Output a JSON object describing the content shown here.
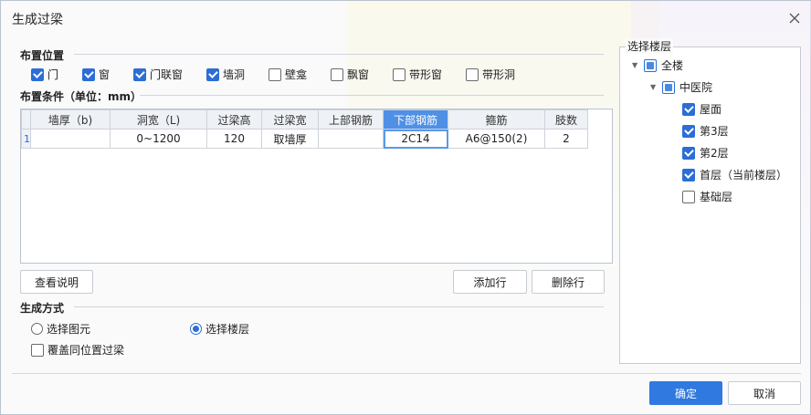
{
  "dialog": {
    "title": "生成过梁",
    "close_icon": "close-icon"
  },
  "placement": {
    "label": "布置位置",
    "options": [
      {
        "label": "门",
        "checked": true
      },
      {
        "label": "窗",
        "checked": true
      },
      {
        "label": "门联窗",
        "checked": true
      },
      {
        "label": "墙洞",
        "checked": true
      },
      {
        "label": "壁龛",
        "checked": false
      },
      {
        "label": "飘窗",
        "checked": false
      },
      {
        "label": "带形窗",
        "checked": false
      },
      {
        "label": "带形洞",
        "checked": false
      }
    ]
  },
  "conditions": {
    "label": "布置条件（单位：mm）",
    "columns": [
      "墙厚（b)",
      "洞宽（L)",
      "过梁高",
      "过梁宽",
      "上部钢筋",
      "下部钢筋",
      "箍筋",
      "肢数"
    ],
    "active_column": "下部钢筋",
    "rows": [
      {
        "index": "1",
        "cells": [
          "",
          "0~1200",
          "120",
          "取墙厚",
          "",
          "2C14",
          "A6@150(2)",
          "2"
        ]
      }
    ]
  },
  "buttons": {
    "help": "查看说明",
    "add_row": "添加行",
    "delete_row": "删除行",
    "ok": "确定",
    "cancel": "取消"
  },
  "generate": {
    "label": "生成方式",
    "mode_select_element": "选择图元",
    "mode_select_floor": "选择楼层",
    "selected_mode": "选择楼层",
    "overwrite_label": "覆盖同位置过梁",
    "overwrite_checked": false
  },
  "floors": {
    "label": "选择楼层",
    "root": {
      "label": "全楼",
      "state": "partial"
    },
    "project": {
      "label": "中医院",
      "state": "partial"
    },
    "items": [
      {
        "label": "屋面",
        "checked": true
      },
      {
        "label": "第3层",
        "checked": true
      },
      {
        "label": "第2层",
        "checked": true
      },
      {
        "label": "首层（当前楼层）",
        "checked": true
      },
      {
        "label": "基础层",
        "checked": false
      }
    ]
  },
  "colors": {
    "accent": "#2f79e0",
    "active_header": "#4f8fe6"
  }
}
